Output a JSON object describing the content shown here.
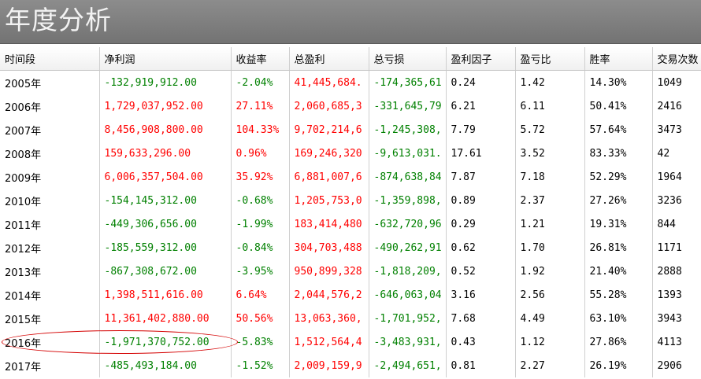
{
  "title": "年度分析",
  "columns": [
    "时间段",
    "净利润",
    "收益率",
    "总盈利",
    "总亏损",
    "盈利因子",
    "盈亏比",
    "胜率",
    "交易次数"
  ],
  "colors": {
    "positive": "#ff0000",
    "negative": "#008000",
    "annotation": "#d40000"
  },
  "rows": [
    {
      "period": "2005年",
      "net": "-132,919,912.00",
      "ret": "-2.04%",
      "gain": "41,445,684.",
      "loss": "-174,365,61",
      "pf": "0.24",
      "plr": "1.42",
      "win": "14.30%",
      "trades": "1049",
      "sign": "neg"
    },
    {
      "period": "2006年",
      "net": "1,729,037,952.00",
      "ret": "27.11%",
      "gain": "2,060,685,3",
      "loss": "-331,645,79",
      "pf": "6.21",
      "plr": "6.11",
      "win": "50.41%",
      "trades": "2416",
      "sign": "pos"
    },
    {
      "period": "2007年",
      "net": "8,456,908,800.00",
      "ret": "104.33%",
      "gain": "9,702,214,6",
      "loss": "-1,245,308,",
      "pf": "7.79",
      "plr": "5.72",
      "win": "57.64%",
      "trades": "3473",
      "sign": "pos"
    },
    {
      "period": "2008年",
      "net": "159,633,296.00",
      "ret": "0.96%",
      "gain": "169,246,320",
      "loss": "-9,613,031.",
      "pf": "17.61",
      "plr": "3.52",
      "win": "83.33%",
      "trades": "42",
      "sign": "pos"
    },
    {
      "period": "2009年",
      "net": "6,006,357,504.00",
      "ret": "35.92%",
      "gain": "6,881,007,6",
      "loss": "-874,638,84",
      "pf": "7.87",
      "plr": "7.18",
      "win": "52.29%",
      "trades": "1964",
      "sign": "pos"
    },
    {
      "period": "2010年",
      "net": "-154,145,312.00",
      "ret": "-0.68%",
      "gain": "1,205,753,0",
      "loss": "-1,359,898,",
      "pf": "0.89",
      "plr": "2.37",
      "win": "27.26%",
      "trades": "3236",
      "sign": "neg"
    },
    {
      "period": "2011年",
      "net": "-449,306,656.00",
      "ret": "-1.99%",
      "gain": "183,414,480",
      "loss": "-632,720,96",
      "pf": "0.29",
      "plr": "1.21",
      "win": "19.31%",
      "trades": "844",
      "sign": "neg"
    },
    {
      "period": "2012年",
      "net": "-185,559,312.00",
      "ret": "-0.84%",
      "gain": "304,703,488",
      "loss": "-490,262,91",
      "pf": "0.62",
      "plr": "1.70",
      "win": "26.81%",
      "trades": "1171",
      "sign": "neg"
    },
    {
      "period": "2013年",
      "net": "-867,308,672.00",
      "ret": "-3.95%",
      "gain": "950,899,328",
      "loss": "-1,818,209,",
      "pf": "0.52",
      "plr": "1.92",
      "win": "21.40%",
      "trades": "2888",
      "sign": "neg"
    },
    {
      "period": "2014年",
      "net": "1,398,511,616.00",
      "ret": "6.64%",
      "gain": "2,044,576,2",
      "loss": "-646,063,04",
      "pf": "3.16",
      "plr": "2.56",
      "win": "55.28%",
      "trades": "1393",
      "sign": "pos"
    },
    {
      "period": "2015年",
      "net": "11,361,402,880.00",
      "ret": "50.56%",
      "gain": "13,063,360,",
      "loss": "-1,701,952,",
      "pf": "7.68",
      "plr": "4.49",
      "win": "63.10%",
      "trades": "3943",
      "sign": "pos"
    },
    {
      "period": "2016年",
      "net": "-1,971,370,752.00",
      "ret": "-5.83%",
      "gain": "1,512,564,4",
      "loss": "-3,483,931,",
      "pf": "0.43",
      "plr": "1.12",
      "win": "27.86%",
      "trades": "4113",
      "sign": "neg"
    },
    {
      "period": "2017年",
      "net": "-485,493,184.00",
      "ret": "-1.52%",
      "gain": "2,009,159,9",
      "loss": "-2,494,651,",
      "pf": "0.81",
      "plr": "2.27",
      "win": "26.19%",
      "trades": "2906",
      "sign": "neg"
    }
  ]
}
